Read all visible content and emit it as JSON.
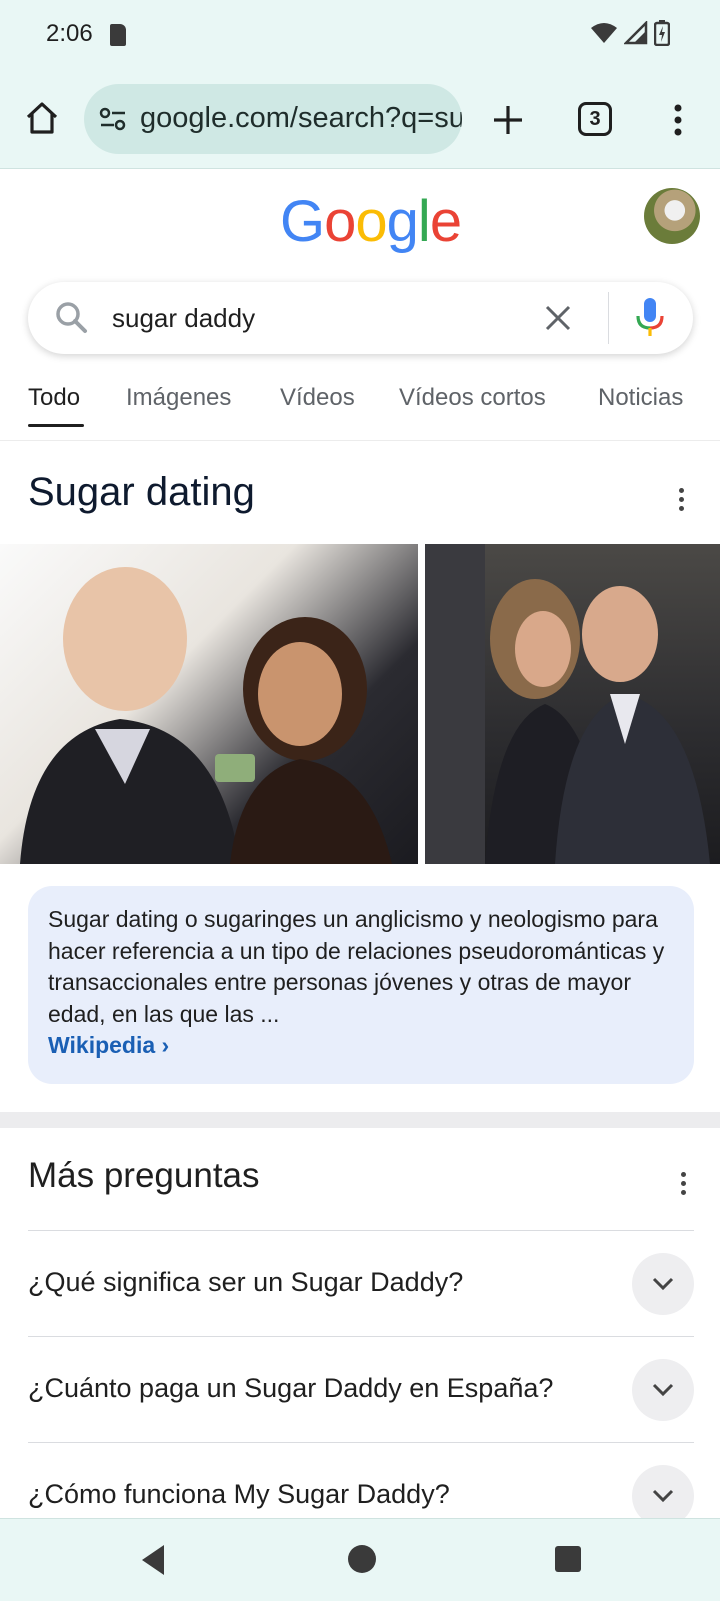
{
  "status_bar": {
    "time": "2:06"
  },
  "browser": {
    "url": "google.com/search?q=su",
    "tab_count": "3"
  },
  "google": {
    "logo_letters": [
      "G",
      "o",
      "o",
      "g",
      "l",
      "e"
    ],
    "logo_colors": [
      "#4285F4",
      "#EA4335",
      "#FBBC05",
      "#4285F4",
      "#34A853",
      "#EA4335"
    ]
  },
  "search": {
    "query": "sugar daddy"
  },
  "tabs": [
    {
      "label": "Todo"
    },
    {
      "label": "Imágenes"
    },
    {
      "label": "Vídeos"
    },
    {
      "label": "Vídeos cortos"
    },
    {
      "label": "Noticias"
    }
  ],
  "knowledge": {
    "title": "Sugar dating",
    "snippet": "Sugar dating o sugaringes un anglicismo y neologismo para hacer referencia a un tipo de relaciones pseudorománticas y transaccionales entre personas jóvenes y otras de mayor edad, en las que las ...",
    "source": "Wikipedia"
  },
  "more_questions": {
    "title": "Más preguntas",
    "items": [
      {
        "q": "¿Qué significa ser un Sugar Daddy?"
      },
      {
        "q": "¿Cuánto paga un Sugar Daddy en España?"
      },
      {
        "q": "¿Cómo funciona My Sugar Daddy?"
      }
    ]
  },
  "colors": {
    "accent_link": "#1a5fb4",
    "snippet_bg": "#e8eefb",
    "chrome_bg": "#e9f7f5"
  }
}
